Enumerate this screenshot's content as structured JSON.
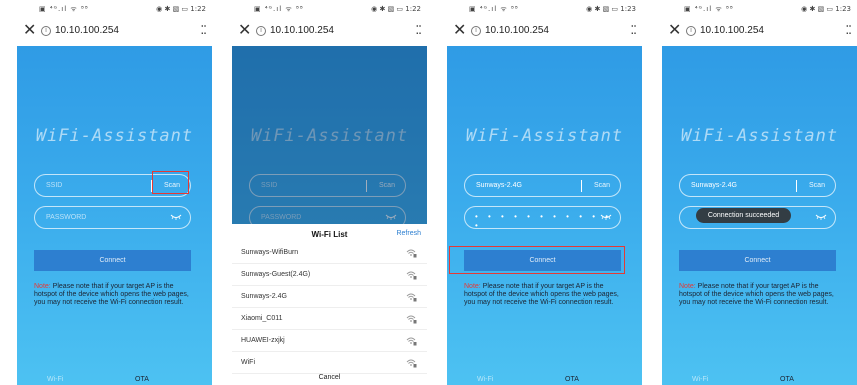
{
  "statusbar": {
    "left": "▣ ⁴ᴳ.ıl ᯤ ⁸⁸",
    "screens": [
      {
        "time_text": "◉ ✱ ▧ ▭ 1:22"
      },
      {
        "time_text": "◉ ✱ ▧ ▭ 1:22"
      },
      {
        "time_text": "◉ ✱ ▧ ▭ 1:23"
      },
      {
        "time_text": "◉ ✱ ▧ ▭ 1:23"
      }
    ]
  },
  "browser": {
    "close": "✕",
    "info": "i",
    "url": "10.10.100.254",
    "more": "⁚⁚"
  },
  "app": {
    "logo": "WiFi-Assistant",
    "ssid_placeholder": "SSID",
    "password_placeholder": "PASSWORD",
    "scan_label": "Scan",
    "connect_label": "Connect",
    "note_label": "Note:",
    "note_text": " Please note that if your target AP is the hotspot of the device which opens the web pages, you may not receive the Wi-Fi connection result.",
    "tab_wifi": "Wi-Fi",
    "tab_ota": "OTA"
  },
  "screen3": {
    "ssid_value": "Sunways-2.4G",
    "password_dots": "• • • • • • • • • • • •"
  },
  "screen4": {
    "ssid_value": "Sunways-2.4G",
    "toast": "Connection succeeded"
  },
  "wifi_list": {
    "title": "Wi-Fi List",
    "refresh": "Refresh",
    "cancel": "Cancel",
    "items": [
      {
        "name": "Sunways-WifiBurn"
      },
      {
        "name": "Sunways-Guest(2.4G)"
      },
      {
        "name": "Sunways-2.4G"
      },
      {
        "name": "Xiaomi_C011"
      },
      {
        "name": "HUAWEI-zxjkj"
      },
      {
        "name": "WiFi"
      }
    ]
  },
  "colors": {
    "gradient_top": "#2f9be5",
    "gradient_bottom": "#4dc2f2",
    "connect_button": "#2d7fd0",
    "highlight": "#e53935",
    "note_red": "#e53935",
    "refresh_blue": "#2d7fd0"
  },
  "icons": {
    "close": "close-icon",
    "info": "info-icon",
    "more": "more-icon",
    "eye": "eye-hidden-icon",
    "wifi": "wifi-lock-icon"
  }
}
